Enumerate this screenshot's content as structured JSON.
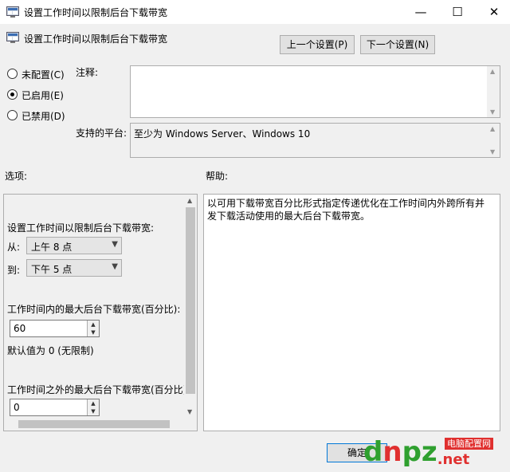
{
  "window": {
    "title": "设置工作时间以限制后台下载带宽",
    "controls": {
      "minimize": "—",
      "maximize": "☐",
      "close": "✕"
    }
  },
  "header": {
    "policy_name": "设置工作时间以限制后台下载带宽",
    "prev_button": "上一个设置(P)",
    "next_button": "下一个设置(N)"
  },
  "state": {
    "options": [
      {
        "label": "未配置(C)",
        "checked": false
      },
      {
        "label": "已启用(E)",
        "checked": true
      },
      {
        "label": "已禁用(D)",
        "checked": false
      }
    ]
  },
  "comment": {
    "label": "注释:",
    "value": ""
  },
  "platform": {
    "label": "支持的平台:",
    "value": "至少为 Windows Server、Windows 10"
  },
  "sections": {
    "options_label": "选项:",
    "help_label": "帮助:"
  },
  "options_panel": {
    "heading": "设置工作时间以限制后台下载带宽:",
    "from_label": "从:",
    "from_value": "上午 8 点",
    "to_label": "到:",
    "to_value": "下午 5 点",
    "inside_label": "工作时间内的最大后台下载带宽(百分比):",
    "inside_value": "60",
    "default_note": "默认值为 0 (无限制)",
    "outside_label": "工作时间之外的最大后台下载带宽(百分比):",
    "outside_value": "0"
  },
  "help_text": "以可用下载带宽百分比形式指定传递优化在工作时间内外跨所有并发下载活动使用的最大后台下载带宽。",
  "footer": {
    "ok_button": "确定"
  },
  "watermark": {
    "part1": "d",
    "part2": "n",
    "part3": "pz",
    "part4": ".net",
    "cn": "电脑配置网"
  },
  "colors": {
    "accent": "#0078d7",
    "watermark_green": "#2fa02f",
    "watermark_red": "#e0302f"
  }
}
